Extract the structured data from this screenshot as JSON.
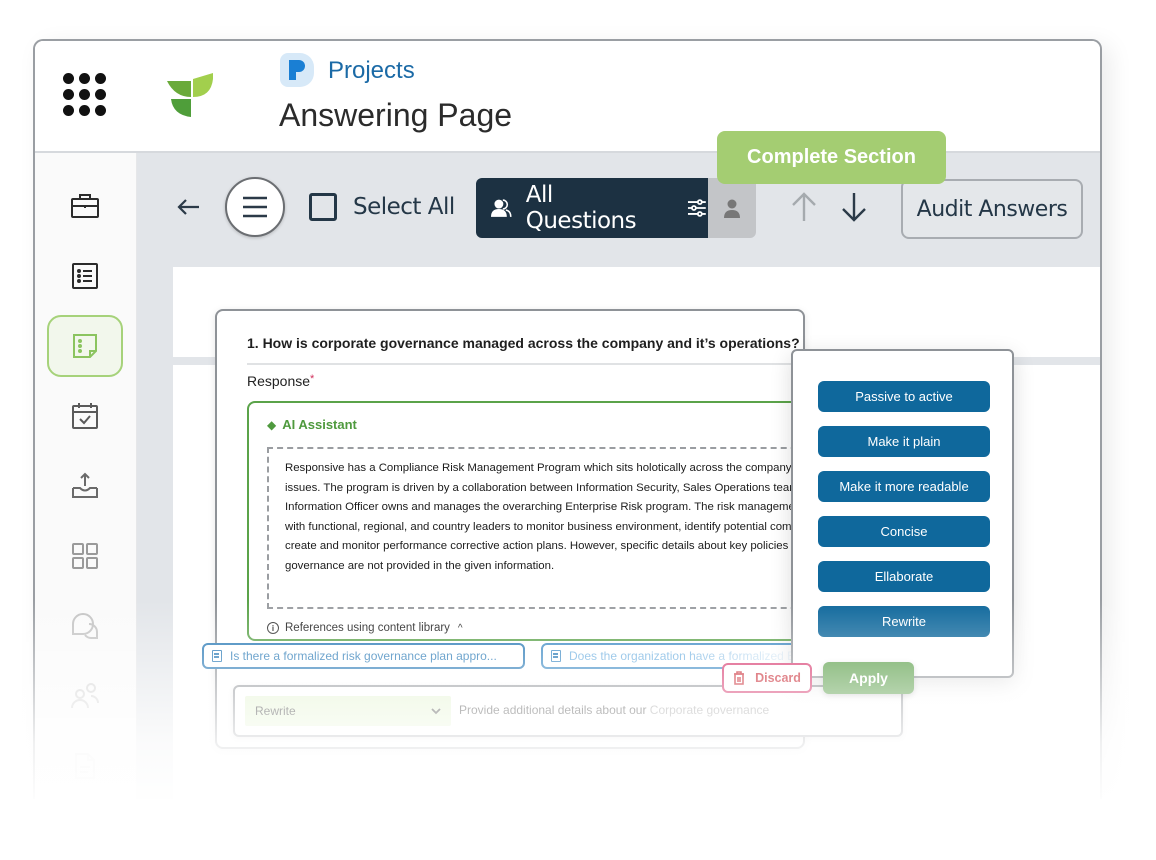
{
  "header": {
    "breadcrumb": "Projects",
    "title": "Answering Page"
  },
  "sidebar": {
    "items": [
      {
        "name": "projects",
        "icon": "briefcase-icon",
        "active": false
      },
      {
        "name": "list",
        "icon": "list-icon",
        "active": false
      },
      {
        "name": "answering",
        "icon": "sticky-note-icon",
        "active": true
      },
      {
        "name": "calendar",
        "icon": "calendar-check-icon",
        "active": false
      },
      {
        "name": "export",
        "icon": "tray-upload-icon",
        "active": false
      },
      {
        "name": "dashboard",
        "icon": "grid-icon",
        "active": false
      },
      {
        "name": "chat",
        "icon": "chat-icon",
        "active": false
      },
      {
        "name": "users",
        "icon": "users-icon",
        "active": false
      },
      {
        "name": "document",
        "icon": "document-icon",
        "active": false
      }
    ]
  },
  "toolbar": {
    "select_all_label": "Select All",
    "filter_label": "All Questions",
    "audit_label": "Audit Answers",
    "complete_section_label": "Complete Section"
  },
  "question": {
    "title": "1. How is corporate governance managed across the company and it’s operations?",
    "response_label": "Response",
    "required_mark": "*",
    "ai_assistant_label": "AI Assistant",
    "ai_text": "Responsive has a Compliance Risk Management Program which sits holotically across the company on compliance issues. The program is driven by a collaboration between Information Security, Sales Operations teams. The Chief Information Officer owns and manages the overarching Enterprise Risk program. The risk management program partners with functional, regional, and country leaders to monitor business environment, identify potential compliance risks, and create and monitor performance corrective action plans. However, specific details about key policies related to corporate governance are not provided in the given information.",
    "references_label": "References using content library",
    "references": [
      "Is there a formalized risk governance plan appro...",
      "Does the organization have a formalized Enterprise"
    ]
  },
  "prompt": {
    "mode": "Rewrite",
    "text_main": "Provide additional details about our ",
    "text_muted": "Corporate governance"
  },
  "ai_actions": [
    "Passive to active",
    "Make it plain",
    "Make it more readable",
    "Concise",
    "Ellaborate",
    "Rewrite"
  ],
  "buttons": {
    "discard": "Discard",
    "apply": "Apply"
  },
  "colors": {
    "brand_green": "#a4cd72",
    "ai_green": "#569c44",
    "action_blue": "#0f689c",
    "nav_dark": "#1c3142",
    "discard_red": "#c8222d"
  }
}
